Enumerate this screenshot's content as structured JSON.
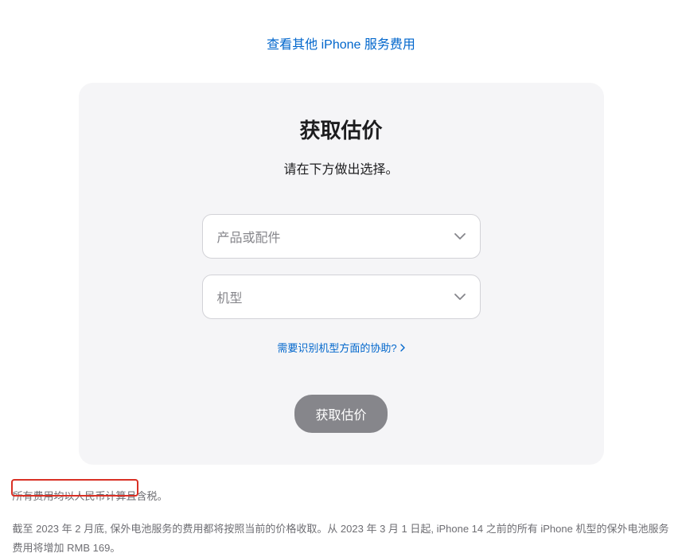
{
  "topLink": {
    "label": "查看其他 iPhone 服务费用"
  },
  "card": {
    "title": "获取估价",
    "subtitle": "请在下方做出选择。",
    "select1": {
      "placeholder": "产品或配件"
    },
    "select2": {
      "placeholder": "机型"
    },
    "helpLink": "需要识别机型方面的协助?",
    "submitLabel": "获取估价"
  },
  "footnote": {
    "line1": "所有费用均以人民币计算且含税。",
    "line2": "截至 2023 年 2 月底, 保外电池服务的费用都将按照当前的价格收取。从 2023 年 3 月 1 日起, iPhone 14 之前的所有 iPhone 机型的保外电池服务费用将增加 RMB 169。"
  }
}
